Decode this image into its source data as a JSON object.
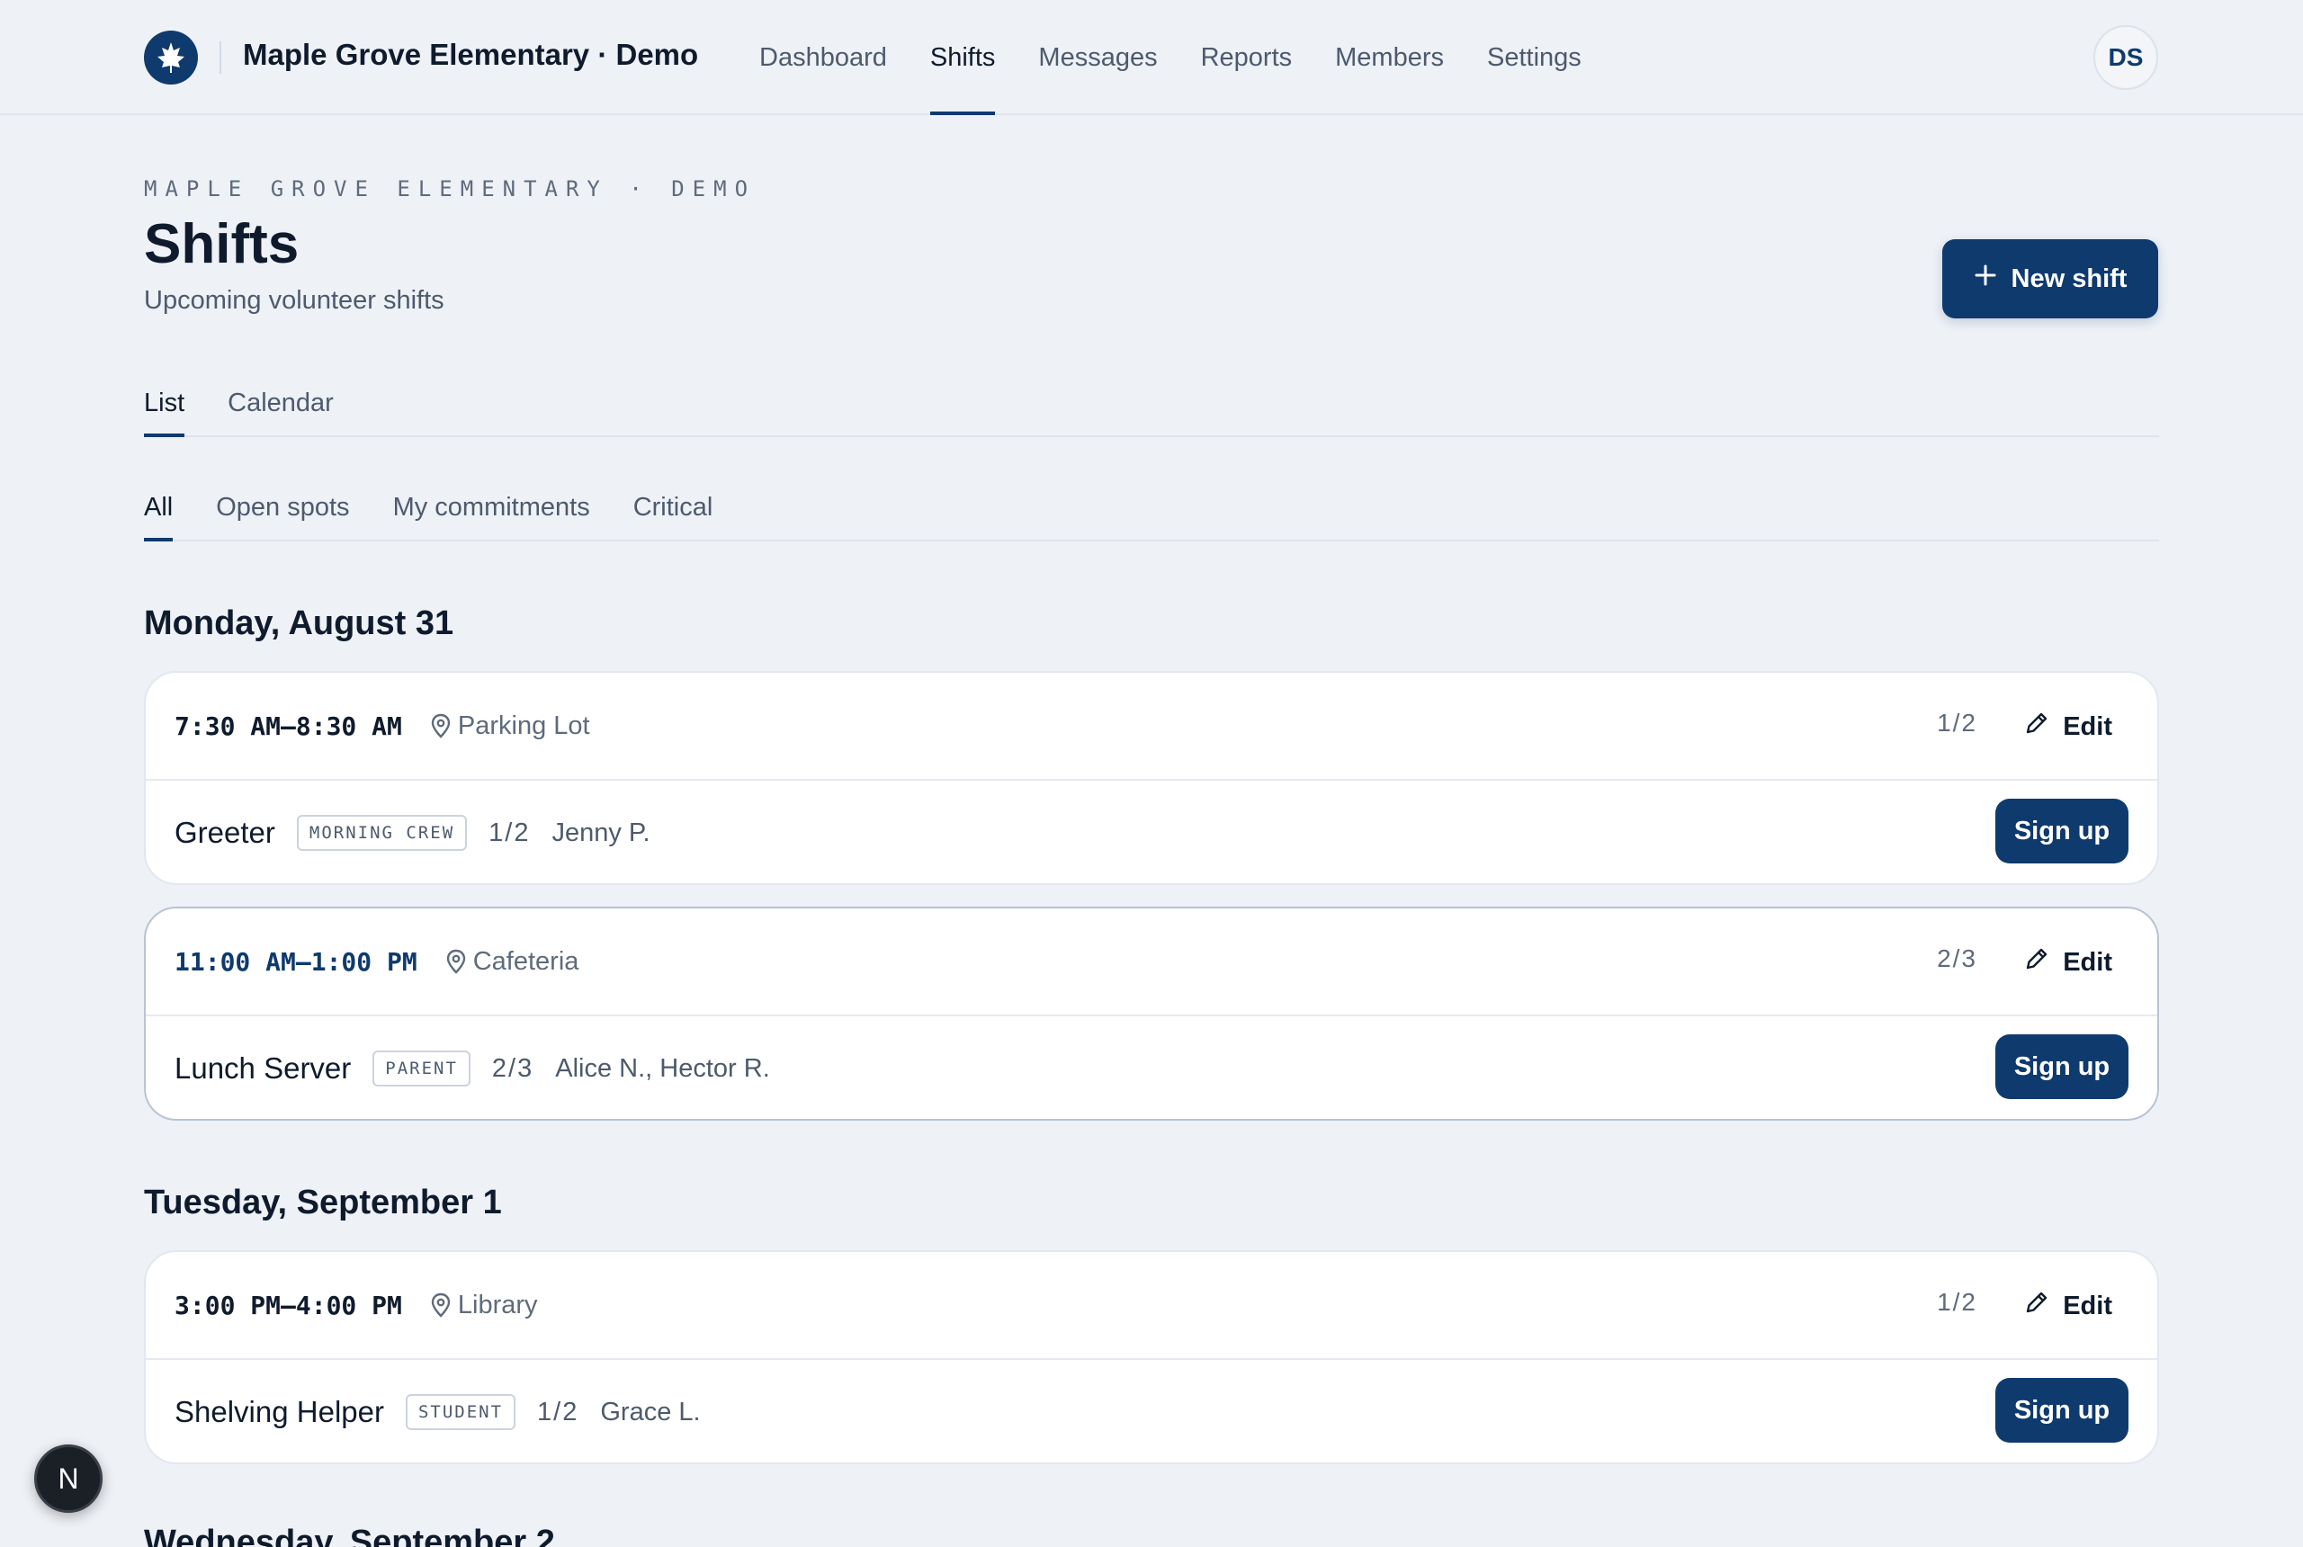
{
  "header": {
    "brand": "Maple Grove Elementary · Demo",
    "nav": [
      {
        "label": "Dashboard",
        "active": false
      },
      {
        "label": "Shifts",
        "active": true
      },
      {
        "label": "Messages",
        "active": false
      },
      {
        "label": "Reports",
        "active": false
      },
      {
        "label": "Members",
        "active": false
      },
      {
        "label": "Settings",
        "active": false
      }
    ],
    "avatar_initials": "DS"
  },
  "page": {
    "eyebrow": "MAPLE GROVE ELEMENTARY · DEMO",
    "title": "Shifts",
    "subtitle": "Upcoming volunteer shifts",
    "new_shift_label": "New shift"
  },
  "view_tabs": [
    {
      "label": "List",
      "active": true
    },
    {
      "label": "Calendar",
      "active": false
    }
  ],
  "filter_tabs": [
    {
      "label": "All",
      "active": true
    },
    {
      "label": "Open spots",
      "active": false
    },
    {
      "label": "My commitments",
      "active": false
    },
    {
      "label": "Critical",
      "active": false
    }
  ],
  "days": [
    {
      "heading": "Monday, August 31",
      "shifts": [
        {
          "time": "7:30 AM–8:30 AM",
          "location": "Parking Lot",
          "ratio": "1/2",
          "edit_label": "Edit",
          "role": "Greeter",
          "tag": "MORNING CREW",
          "role_ratio": "1/2",
          "people": "Jenny P.",
          "signup_label": "Sign up"
        },
        {
          "time": "11:00 AM–1:00 PM",
          "location": "Cafeteria",
          "ratio": "2/3",
          "edit_label": "Edit",
          "role": "Lunch Server",
          "tag": "PARENT",
          "role_ratio": "2/3",
          "people": "Alice N., Hector R.",
          "signup_label": "Sign up"
        }
      ]
    },
    {
      "heading": "Tuesday, September 1",
      "shifts": [
        {
          "time": "3:00 PM–4:00 PM",
          "location": "Library",
          "ratio": "1/2",
          "edit_label": "Edit",
          "role": "Shelving Helper",
          "tag": "STUDENT",
          "role_ratio": "1/2",
          "people": "Grace L.",
          "signup_label": "Sign up"
        }
      ]
    },
    {
      "heading": "Wednesday, September 2",
      "shifts": []
    }
  ],
  "fab_label": "N",
  "colors": {
    "primary": "#0e3a6e",
    "background": "#eef1f6"
  }
}
